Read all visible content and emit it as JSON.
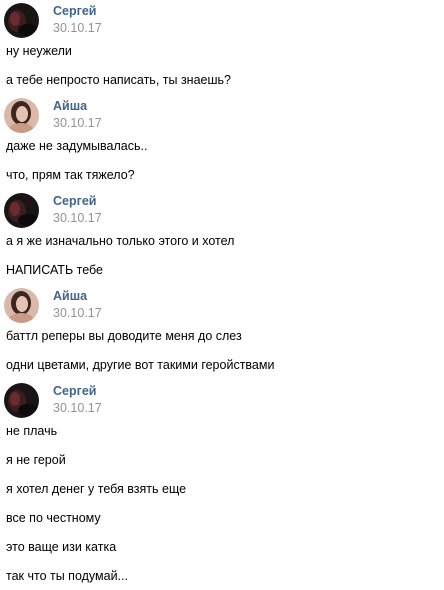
{
  "conversation": {
    "groups": [
      {
        "sender": "Сергей",
        "time": "30.10.17",
        "avatar": "sergey-avatar",
        "messages": [
          "ну неужели",
          "а тебе непросто написать, ты знаешь?"
        ]
      },
      {
        "sender": "Айша",
        "time": "30.10.17",
        "avatar": "aisha-avatar",
        "messages": [
          "даже не задумывалась..",
          "что, прям так тяжело?"
        ]
      },
      {
        "sender": "Сергей",
        "time": "30.10.17",
        "avatar": "sergey-avatar",
        "messages": [
          "а я же изначально только этого и хотел",
          "НАПИСАТЬ тебе"
        ]
      },
      {
        "sender": "Айша",
        "time": "30.10.17",
        "avatar": "aisha-avatar",
        "messages": [
          "баттл реперы вы доводите меня до слез",
          "одни цветами, другие вот такими геройствами"
        ]
      },
      {
        "sender": "Сергей",
        "time": "30.10.17",
        "avatar": "sergey-avatar",
        "messages": [
          "не плачь",
          "я не герой",
          "я хотел денег у тебя взять еще",
          "все по честному",
          "это ваще изи катка",
          "так что ты подумай..."
        ]
      }
    ]
  },
  "colors": {
    "sender_name": "#42648b",
    "timestamp": "#939393",
    "message_text": "#000000",
    "background": "#ffffff"
  }
}
